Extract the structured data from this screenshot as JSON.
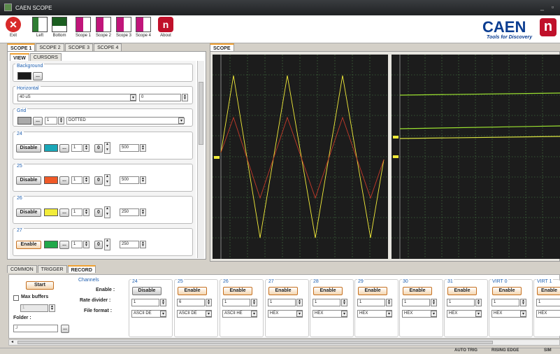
{
  "window": {
    "title": "CAEN SCOPE"
  },
  "toolbar": {
    "exit": "Exit",
    "left": "Left",
    "bottom": "Bottom",
    "scope1": "Scope 1",
    "scope2": "Scope 2",
    "scope3": "Scope 3",
    "scope4": "Scope 4",
    "about": "About"
  },
  "logo": {
    "brand": "CAEN",
    "tagline": "Tools for Discovery"
  },
  "scope_tabs": [
    "SCOPE 1",
    "SCOPE 2",
    "SCOPE 3",
    "SCOPE 4"
  ],
  "sub_tabs": [
    "VIEW",
    "CURSORS"
  ],
  "view": {
    "background_label": "Background",
    "horizontal_label": "Horizontal",
    "horizontal_value": "40 uS",
    "horizontal_offset": "0",
    "grid_label": "Grid",
    "grid_width": "1",
    "grid_style": "DOTTED",
    "more_btn": "..."
  },
  "channels_view": [
    {
      "name": "24",
      "button": "Disable",
      "color": "#1aa7b8",
      "width": "1",
      "mode": "0",
      "value": "500"
    },
    {
      "name": "25",
      "button": "Disable",
      "color": "#f05a28",
      "width": "1",
      "mode": "0",
      "value": "500"
    },
    {
      "name": "26",
      "button": "Disable",
      "color": "#f2ec3a",
      "width": "1",
      "mode": "0",
      "value": "250"
    },
    {
      "name": "27",
      "button": "Enable",
      "color": "#21a84a",
      "width": "1",
      "mode": "0",
      "value": "250"
    }
  ],
  "scope_panel_tab": "SCOPE",
  "bottom_tabs": [
    "COMMON",
    "TRIGGER",
    "RECORD"
  ],
  "record": {
    "start": "Start",
    "max_buffers": "Max buffers",
    "max_buffers_value": "1",
    "folder_label": "Folder :",
    "folder_value": "./",
    "folder_btn": "...",
    "channels_title": "Channels",
    "enable_label": "Enable :",
    "rate_label": "Rate divider :",
    "format_label": "File format :"
  },
  "record_channels": [
    {
      "name": "24",
      "button": "Disable",
      "rate": "1",
      "format": "ASCII DE"
    },
    {
      "name": "25",
      "button": "Enable",
      "rate": "6",
      "format": "ASCII DE"
    },
    {
      "name": "26",
      "button": "Enable",
      "rate": "1",
      "format": "ASCII HE"
    },
    {
      "name": "27",
      "button": "Enable",
      "rate": "1",
      "format": "HEX"
    },
    {
      "name": "28",
      "button": "Enable",
      "rate": "1",
      "format": "HEX"
    },
    {
      "name": "29",
      "button": "Enable",
      "rate": "1",
      "format": "HEX"
    },
    {
      "name": "30",
      "button": "Enable",
      "rate": "1",
      "format": "HEX"
    },
    {
      "name": "31",
      "button": "Enable",
      "rate": "1",
      "format": "HEX"
    },
    {
      "name": "VIRT 0",
      "button": "Enable",
      "rate": "1",
      "format": "HEX"
    },
    {
      "name": "VIRT 1",
      "button": "Enable",
      "rate": "1",
      "format": "HEX"
    }
  ],
  "statusbar": {
    "trig": "AUTO TRIG",
    "edge": "RISING EDGE",
    "sim": "SIM"
  },
  "colors": {
    "trace_a": "#f2ec3a",
    "trace_b": "#c43a2a",
    "trace_green": "#9be030",
    "grid": "#4f8a4a"
  }
}
